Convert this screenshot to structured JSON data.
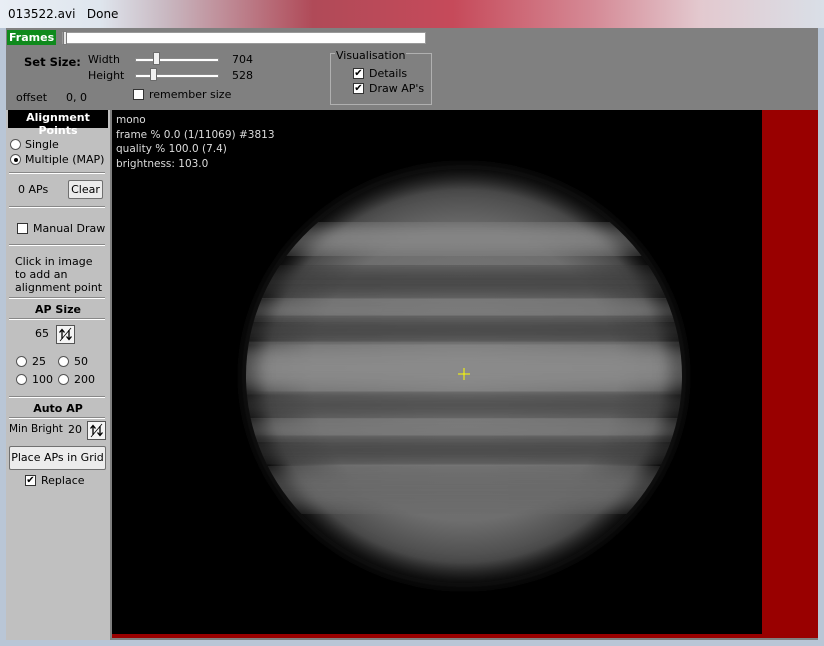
{
  "window": {
    "title": "013522.avi   Done"
  },
  "frames": {
    "label": "Frames",
    "position": 0.0
  },
  "set_size": {
    "label": "Set Size:",
    "width_label": "Width",
    "width_value": "704",
    "height_label": "Height",
    "height_value": "528",
    "remember_label": "remember size",
    "remember_checked": false
  },
  "offset": {
    "label": "offset",
    "value": "0, 0"
  },
  "visualisation": {
    "title": "Visualisation",
    "details_label": "Details",
    "details_checked": true,
    "draw_aps_label": "Draw AP's",
    "draw_aps_checked": true
  },
  "alignment": {
    "title": "Alignment Points",
    "single_label": "Single",
    "multiple_label": "Multiple (MAP)",
    "selected": "multiple",
    "ap_count": "0 APs",
    "clear_label": "Clear",
    "manual_draw_label": "Manual Draw",
    "manual_draw_checked": false,
    "hint": "Click in image to add an alignment point"
  },
  "ap_size": {
    "title": "AP Size",
    "value": "65",
    "options": [
      "25",
      "50",
      "100",
      "200"
    ]
  },
  "auto_ap": {
    "title": "Auto AP",
    "min_bright_label": "Min Bright",
    "min_bright_value": "20",
    "place_label": "Place APs in Grid",
    "replace_label": "Replace",
    "replace_checked": true
  },
  "overlay": {
    "line1": "mono",
    "line2": "frame % 0.0 (1/11069) #3813",
    "line3": "quality % 100.0  (7.4)",
    "line4": "brightness: 103.0"
  },
  "icons": {
    "spin": "spin-arrows-icon",
    "crosshair": "crosshair-icon"
  },
  "colors": {
    "frames_green": "#0f8a1c",
    "red_panel": "#990000",
    "crosshair": "#ffff00"
  }
}
